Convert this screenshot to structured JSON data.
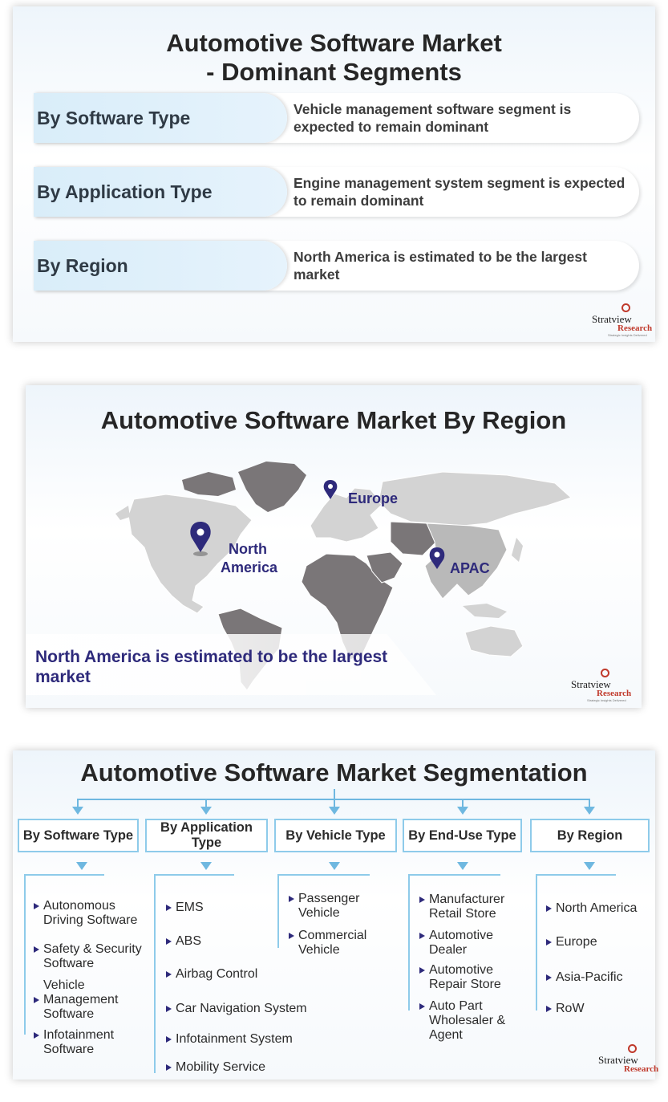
{
  "card1": {
    "title_line1": "Automotive Software Market",
    "title_line2": "- Dominant Segments",
    "rows": [
      {
        "label": "By Software Type",
        "desc": "Vehicle management software segment is expected to remain dominant"
      },
      {
        "label": "By Application Type",
        "desc": "Engine management system segment is expected to remain dominant"
      },
      {
        "label": "By Region",
        "desc": "North America is estimated to be the largest market"
      }
    ]
  },
  "logo": {
    "name": "Stratview",
    "sub": "Research",
    "tagline": "Strategic Insights Delivered",
    "tm": "™"
  },
  "card2": {
    "title": "Automotive Software Market By Region",
    "pins": {
      "europe": "Europe",
      "north_america_1": "North",
      "north_america_2": "America",
      "apac": "APAC"
    },
    "banner": "North America is estimated to be the largest market"
  },
  "card3": {
    "title": "Automotive Software Market Segmentation",
    "categories": [
      {
        "label": "By Software Type",
        "items": [
          "Autonomous Driving Software",
          "Safety & Security Software",
          "Vehicle Management Software",
          "Infotainment Software"
        ]
      },
      {
        "label": "By Application Type",
        "items": [
          "EMS",
          "ABS",
          "Airbag Control",
          "Car Navigation System",
          "Infotainment System",
          "Mobility Service"
        ]
      },
      {
        "label": "By Vehicle Type",
        "items": [
          "Passenger Vehicle",
          "Commercial Vehicle"
        ]
      },
      {
        "label": "By End-Use Type",
        "items": [
          "Manufacturer Retail Store",
          "Automotive Dealer",
          "Automotive Repair Store",
          "Auto Part Wholesaler & Agent"
        ]
      },
      {
        "label": "By Region",
        "items": [
          "North America",
          "Europe",
          "Asia-Pacific",
          "RoW"
        ]
      }
    ]
  },
  "colors": {
    "accent": "#2e2a7b",
    "connector": "#6fb8e0",
    "label_bg": "#d9edf9",
    "map_dark": "#7a7678",
    "map_light": "#d3d3d3",
    "brand_red": "#c0392b"
  }
}
